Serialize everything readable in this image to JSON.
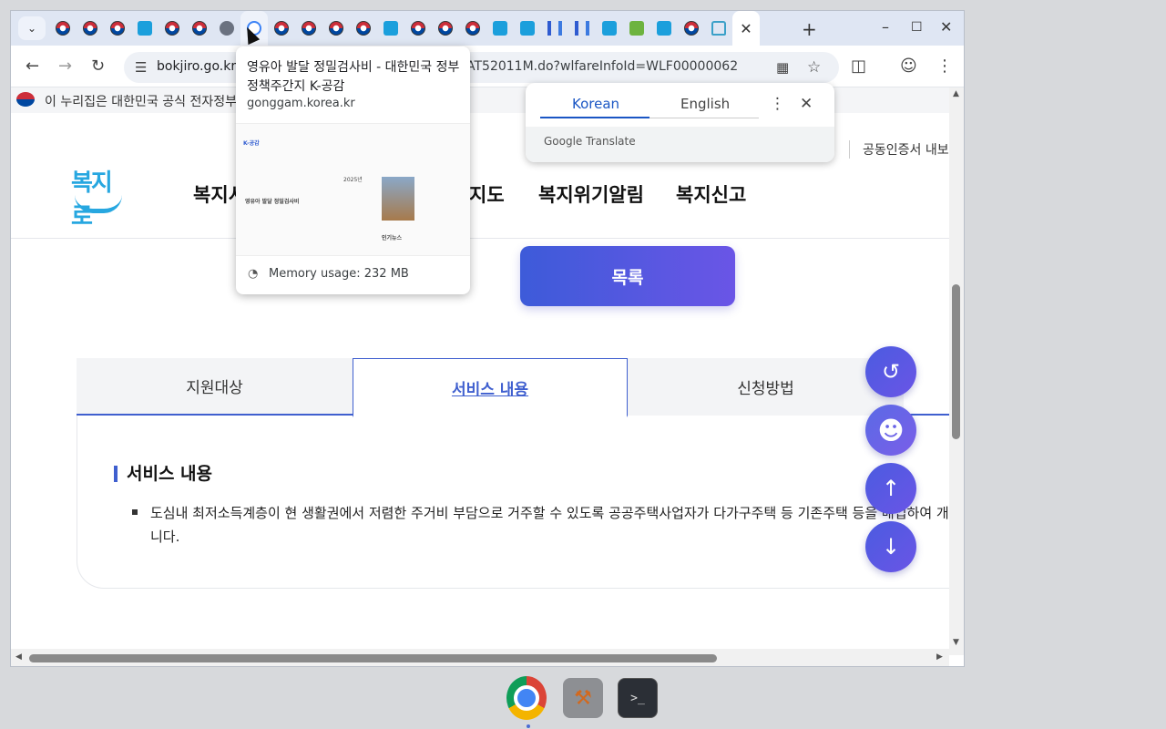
{
  "browser": {
    "tabs": [
      {
        "icon": "korea-gov-icon"
      },
      {
        "icon": "korea-gov-icon"
      },
      {
        "icon": "korea-gov-icon"
      },
      {
        "icon": "bokjiro-icon"
      },
      {
        "icon": "korea-gov-icon"
      },
      {
        "icon": "korea-gov-icon"
      },
      {
        "icon": "globe-icon"
      },
      {
        "icon": "gonggam-icon"
      },
      {
        "icon": "korea-gov-icon"
      },
      {
        "icon": "korea-gov-icon"
      },
      {
        "icon": "korea-gov-icon"
      },
      {
        "icon": "korea-gov-icon"
      },
      {
        "icon": "bokjiro-icon"
      },
      {
        "icon": "korea-gov-icon"
      },
      {
        "icon": "korea-gov-icon"
      },
      {
        "icon": "korea-gov-icon"
      },
      {
        "icon": "bokjiro-icon"
      },
      {
        "icon": "bokjiro-icon"
      },
      {
        "icon": "building-icon"
      },
      {
        "icon": "building-icon"
      },
      {
        "icon": "bokjiro-icon"
      },
      {
        "icon": "lh-icon"
      },
      {
        "icon": "bokjiro-icon"
      },
      {
        "icon": "korea-gov-icon"
      },
      {
        "icon": "home-icon"
      }
    ],
    "url_host": "bokjiro.go.kr",
    "url_rest": "AT52011M.do?wlfareInfoId=WLF00000062"
  },
  "gov_banner": "이 누리집은 대한민국 공식 전자정부",
  "header": {
    "nav": [
      "복지서",
      "지도",
      "복지위기알림",
      "복지신고"
    ],
    "cert_link": "공동인증서 내보"
  },
  "list_button": "목록",
  "content_tabs": [
    "지원대상",
    "서비스 내용",
    "신청방법"
  ],
  "service": {
    "title": "서비스 내용",
    "description": "도심내 최저소득계층이 현 생활권에서 저렴한 주거비 부담으로 거주할 수 있도록 공공주택사업자가 다가구주택 등 기존주택 등을 매입하여 개보",
    "description_cont": "니다."
  },
  "translate_popup": {
    "lang_source": "Korean",
    "lang_target": "English",
    "brand": "Google Translate"
  },
  "hover_card": {
    "title": "영유아 발달 정밀검사비 - 대한민국 정부 정책주간지 K-공감",
    "domain": "gonggam.korea.kr",
    "memory": "Memory usage: 232 MB",
    "thumb_article": "영유아 발달 정밀검사비",
    "thumb_popular": "인기뉴스",
    "thumb_brand": "K-공감",
    "thumb_year": "2025년"
  }
}
